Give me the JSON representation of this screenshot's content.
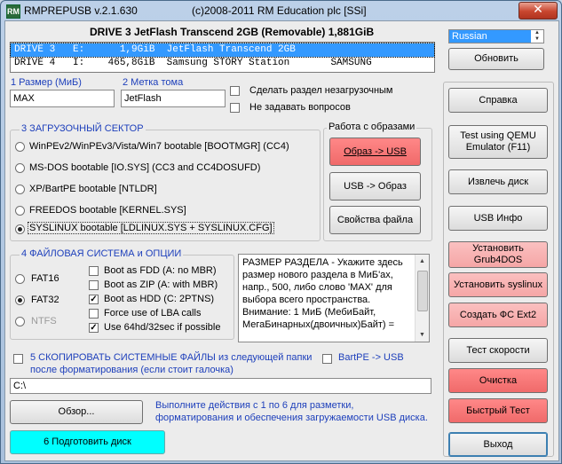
{
  "window": {
    "title": "RMPREPUSB v.2.1.630",
    "copyright": "(c)2008-2011 RM Education plc [SSi]",
    "close_symbol": "✕",
    "app_icon": "RM"
  },
  "drive_header": "DRIVE 3 JetFlash Transcend 2GB  (Removable) 1,881GiB",
  "drives": [
    "DRIVE 3   E:      1,9GiB  JetFlash Transcend 2GB",
    "DRIVE 4   I:    465,8GiB  Samsung STORY Station       SAMSUNG"
  ],
  "language": {
    "value": "Russian",
    "spin_up": "▲",
    "spin_down": "▼"
  },
  "size_label": "1 Размер (МиБ)",
  "size_value": "MAX",
  "volume_label": "2 Метка тома",
  "volume_value": "JetFlash",
  "options": {
    "non_bootable": "Сделать раздел незагрузочным",
    "no_questions": "Не задавать вопросов"
  },
  "boot_sector": {
    "title": "3 ЗАГРУЗОЧНЫЙ СЕКТОР",
    "items": [
      "WinPEv2/WinPEv3/Vista/Win7 bootable [BOOTMGR] (CC4)",
      "MS-DOS bootable [IO.SYS]    (CC3 and CC4DOSUFD)",
      "XP/BartPE bootable [NTLDR]",
      "FREEDOS bootable [KERNEL.SYS]",
      "SYSLINUX bootable [LDLINUX.SYS + SYSLINUX.CFG]"
    ]
  },
  "image_group": {
    "title": "Работа с образами",
    "to_usb": "Образ -> USB",
    "to_image": "USB -> Образ",
    "file_props": "Свойства файла"
  },
  "fs_group": {
    "title": "4 ФАЙЛОВАЯ СИСТЕМА и ОПЦИИ",
    "fs": [
      "FAT16",
      "FAT32",
      "NTFS"
    ],
    "checks": [
      "Boot as FDD (A: no MBR)",
      "Boot as ZIP (A: with MBR)",
      "Boot as HDD (C: 2PTNS)",
      "Force use of LBA calls",
      "Use 64hd/32sec if possible"
    ],
    "check_mark": "✓"
  },
  "info_text": "РАЗМЕР РАЗДЕЛА - Укажите здесь размер нового раздела в МиБ'ах, напр., 500, либо слово 'MAX' для выбора всего пространства. Внимание: 1 МиБ (МебиБайт, МегаБинарных(двоичных)Байт) =",
  "memo_scroll": {
    "up": "▲",
    "down": "▼"
  },
  "copy_files": {
    "label_line1": "5 СКОПИРОВАТЬ СИСТЕМНЫЕ ФАЙЛЫ из следующей папки",
    "label_line2": "после форматирования (если стоит галочка)",
    "bartpe": "BartPE -> USB",
    "path": "C:\\"
  },
  "browse_button": "Обзор...",
  "instructions": "Выполните действия с 1 по 6 для разметки, форматирования и обеспечения загружаемости USB диска.",
  "prepare_button": "6 Подготовить диск",
  "right_buttons": {
    "refresh": "Обновить",
    "help": "Справка",
    "qemu_line1": "Test using QEMU",
    "qemu_line2": "Emulator (F11)",
    "eject": "Извлечь диск",
    "usb_info": "USB Инфо",
    "grub_line1": "Установить",
    "grub_line2": "Grub4DOS",
    "syslinux": "Установить syslinux",
    "ext2": "Создать ФС Ext2",
    "speed": "Тест скорости",
    "clean": "Очистка",
    "quick": "Быстрый Тест",
    "exit": "Выход"
  }
}
